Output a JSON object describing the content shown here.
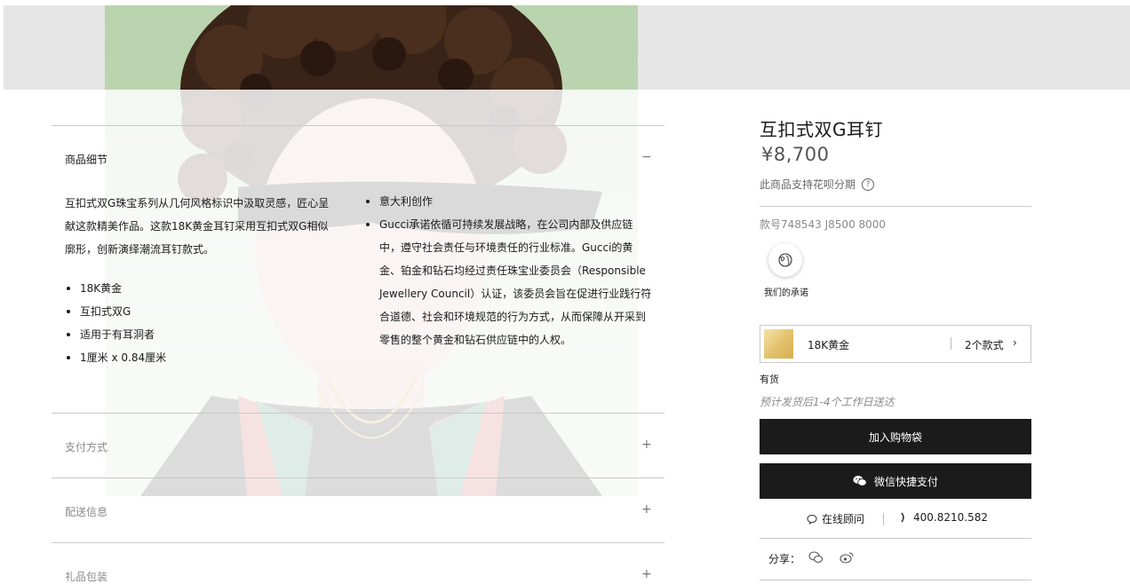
{
  "hero": {
    "image": "model-with-curly-hair-and-earrings"
  },
  "details": {
    "title": "商品细节",
    "toggle": "−",
    "description": "互扣式双G珠宝系列从几何风格标识中汲取灵感，匠心呈献这款精美作品。这款18K黄金耳钉采用互扣式双G相似廓形，创新演绎潮流耳钉款式。",
    "features": [
      "18K黄金",
      "互扣式双G",
      "适用于有耳洞者",
      "1厘米 x 0.84厘米"
    ],
    "origin": "意大利创作",
    "commitment": "Gucci承诺依循可持续发展战略，在公司内部及供应链中，遵守社会责任与环境责任的行业标准。Gucci的黄金、铂金和钻石均经过责任珠宝业委员会（Responsible Jewellery Council）认证，该委员会旨在促进行业践行符合道德、社会和环境规范的行为方式，从而保障从开采到零售的整个黄金和钻石供应链中的人权。"
  },
  "accordion": [
    {
      "title": "支付方式",
      "toggle": "+"
    },
    {
      "title": "配送信息",
      "toggle": "+"
    },
    {
      "title": "礼品包装",
      "toggle": "+"
    }
  ],
  "product": {
    "title": "互扣式双G耳钉",
    "price": "¥8,700",
    "installment": "此商品支持花呗分期",
    "help_icon": "?",
    "style_number": "款号748543 J8500 8000",
    "promise_label": "我们的承诺",
    "variant": {
      "name": "18K黄金",
      "count": "2个款式",
      "chevron": "›",
      "swatch_color": "#e2c06b"
    },
    "stock": "有货",
    "ship_note": "预计发货后1-4个工作日送达",
    "add_to_bag": "加入购物袋",
    "wechat_pay": "微信快捷支付"
  },
  "contact": {
    "chat": "在线顾问",
    "phone": "400.8210.582"
  },
  "share": {
    "label": "分享：",
    "icons": [
      "wechat-icon",
      "weibo-icon"
    ]
  }
}
